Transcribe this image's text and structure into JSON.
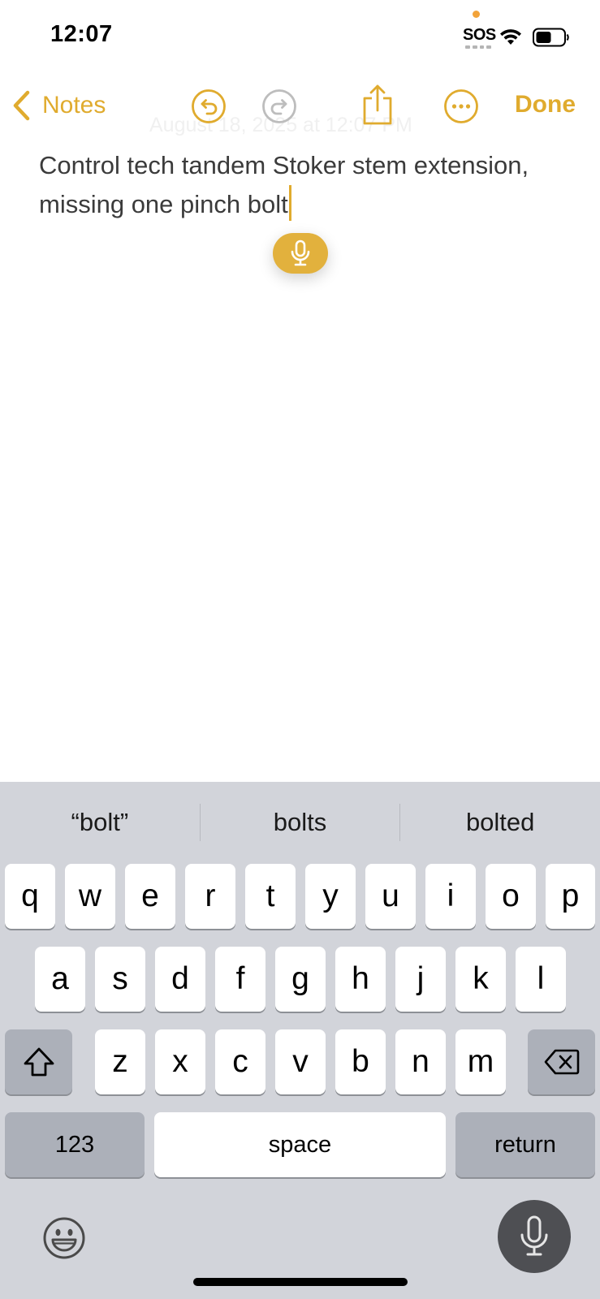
{
  "status_bar": {
    "time": "12:07",
    "sos": "SOS"
  },
  "nav": {
    "back_label": "Notes",
    "done_label": "Done"
  },
  "note": {
    "date": "August 18, 2025 at 12:07 PM",
    "text": "Control tech tandem Stoker stem extension, missing one pinch bolt"
  },
  "keyboard": {
    "suggestions": [
      "“bolt”",
      "bolts",
      "bolted"
    ],
    "row1": [
      "q",
      "w",
      "e",
      "r",
      "t",
      "y",
      "u",
      "i",
      "o",
      "p"
    ],
    "row2": [
      "a",
      "s",
      "d",
      "f",
      "g",
      "h",
      "j",
      "k",
      "l"
    ],
    "row3": [
      "z",
      "x",
      "c",
      "v",
      "b",
      "n",
      "m"
    ],
    "numbers_label": "123",
    "space_label": "space",
    "return_label": "return"
  },
  "colors": {
    "accent": "#e0ab2e",
    "keyboard_bg": "#d2d4da",
    "mic_bg": "#4e4f53"
  }
}
